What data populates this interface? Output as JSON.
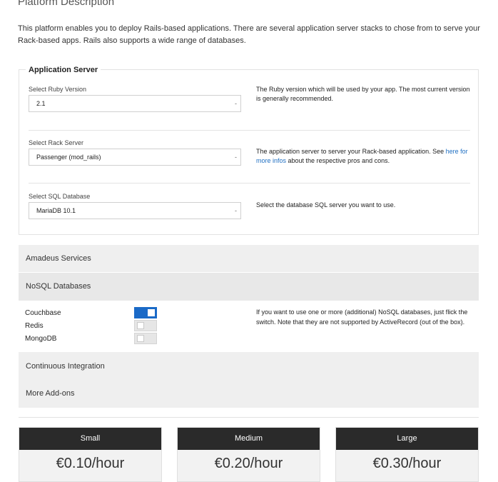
{
  "page": {
    "title": "Platform Description",
    "intro": "This platform enables you to deploy Rails-based applications. There are several application server stacks to chose from to serve your Rack-based apps. Rails also supports a wide range of databases."
  },
  "app_server": {
    "legend": "Application Server",
    "ruby": {
      "label": "Select Ruby Version",
      "value": "2.1",
      "help": "The Ruby version which will be used by your app. The most current version is generally recommended."
    },
    "rack": {
      "label": "Select Rack Server",
      "value": "Passenger (mod_rails)",
      "help_pre": "The application server to server your Rack-based application. See ",
      "help_link": "here for more infos",
      "help_post": " about the respective pros and cons."
    },
    "sql": {
      "label": "Select SQL Database",
      "value": "MariaDB 10.1",
      "help": "Select the database SQL server you want to use."
    },
    "caret": "-"
  },
  "accordion": {
    "amadeus": "Amadeus Services",
    "nosql": "NoSQL Databases",
    "ci": "Continuous Integration",
    "addons": "More Add-ons"
  },
  "nosql": {
    "items": [
      {
        "label": "Couchbase",
        "enabled": true
      },
      {
        "label": "Redis",
        "enabled": false
      },
      {
        "label": "MongoDB",
        "enabled": false
      }
    ],
    "help": "If you want to use one or more (additional) NoSQL databases, just flick the switch. Note that they are not supported by ActiveRecord (out of the box)."
  },
  "plans": [
    {
      "name": "Small",
      "price": "€0.10/hour"
    },
    {
      "name": "Medium",
      "price": "€0.20/hour"
    },
    {
      "name": "Large",
      "price": "€0.30/hour"
    }
  ],
  "colors": {
    "accent": "#1a6ac7",
    "link": "#1f6fc2",
    "plan_header": "#2a2a2a",
    "accordion_bg": "#efefef"
  }
}
